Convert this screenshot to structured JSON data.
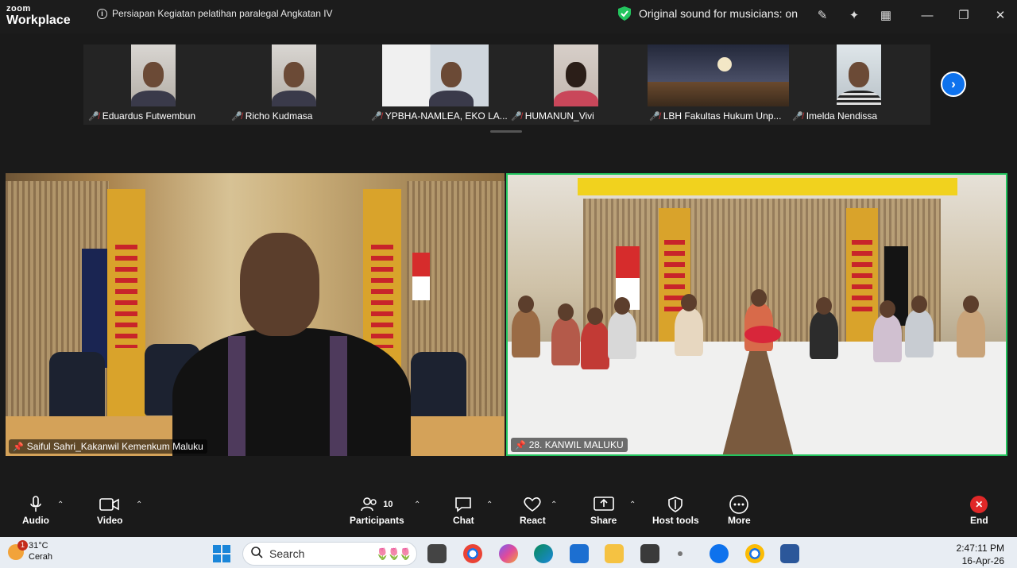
{
  "app": {
    "brand_top": "zoom",
    "brand_bottom": "Workplace"
  },
  "meeting": {
    "title": "Persiapan Kegiatan pelatihan paralegal Angkatan IV",
    "original_sound": "Original sound for musicians: on"
  },
  "participants_strip": [
    {
      "name": "Eduardus Futwembun"
    },
    {
      "name": "Richo Kudmasa"
    },
    {
      "name": "YPBHA-NAMLEA, EKO LA..."
    },
    {
      "name": "HUMANUN_Vivi"
    },
    {
      "name": "LBH Fakultas Hukum Unp..."
    },
    {
      "name": "Imelda Nendissa"
    }
  ],
  "main_tiles": [
    {
      "name": "Saiful Sahri_Kakanwil Kemenkum Maluku",
      "active": false
    },
    {
      "name": "28. KANWIL MALUKU",
      "active": true
    }
  ],
  "toolbar": {
    "audio": "Audio",
    "video": "Video",
    "participants": "Participants",
    "participants_count": "10",
    "chat": "Chat",
    "react": "React",
    "share": "Share",
    "host_tools": "Host tools",
    "more": "More",
    "end": "End"
  },
  "taskbar": {
    "temp": "31°C",
    "condition": "Cerah",
    "notification_count": "1",
    "search_placeholder": "Search",
    "time": "2:47:11 PM",
    "date": "16-Apr-26"
  },
  "colors": {
    "active_speaker": "#23c55e",
    "zoom_blue": "#0e72ed",
    "end_red": "#e02828",
    "muted_red": "#e0353b"
  }
}
